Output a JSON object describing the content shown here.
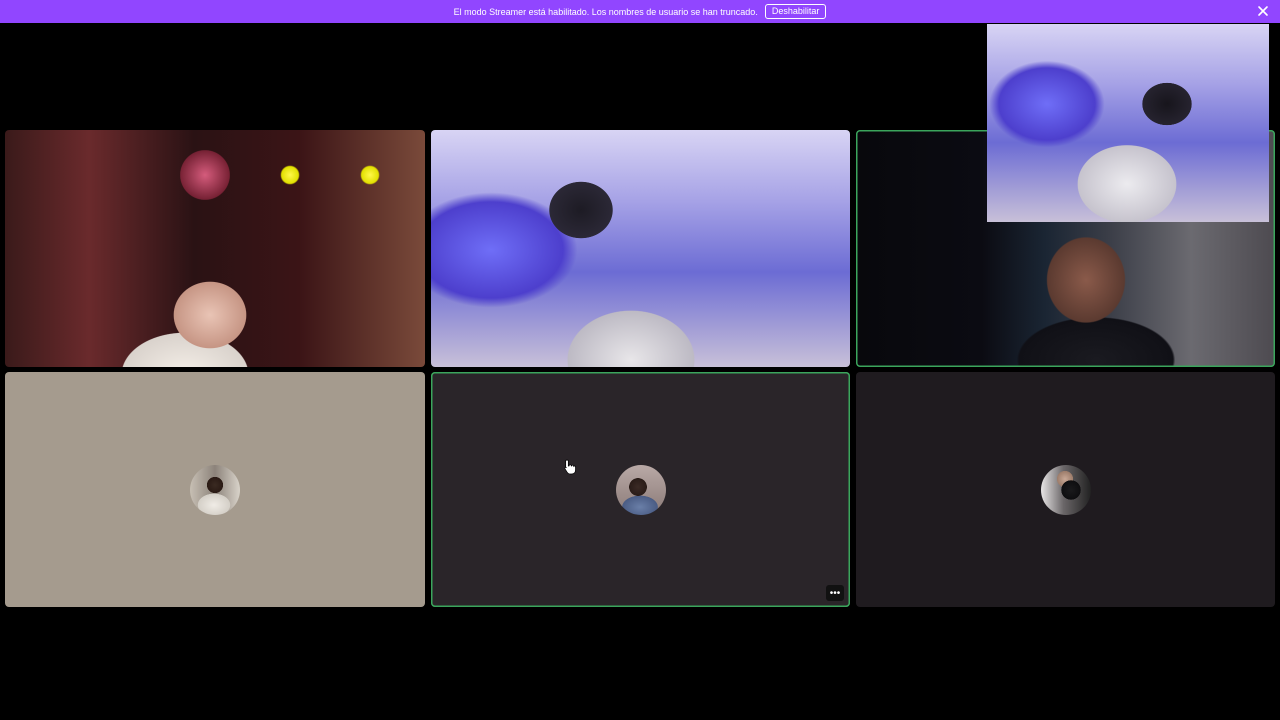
{
  "banner": {
    "message": "El modo Streamer está habilitado. Los nombres de usuario se han truncado.",
    "disable_label": "Deshabilitar",
    "close_icon": "close-icon",
    "background_color": "#9146ff"
  },
  "participants": {
    "video_tiles": [
      {
        "id": "video-1",
        "type": "camera"
      },
      {
        "id": "video-2",
        "type": "camera"
      },
      {
        "id": "video-3",
        "type": "camera",
        "speaking": true
      }
    ],
    "pip": {
      "type": "camera"
    },
    "avatar_tiles": [
      {
        "id": "avatar-1",
        "background_color": "#a59b8e"
      },
      {
        "id": "avatar-2",
        "background_color": "#2a2529",
        "speaking": true,
        "more_label": "•••"
      },
      {
        "id": "avatar-3",
        "background_color": "#1f1b1f"
      }
    ]
  },
  "speaking_color": "#3ba55c"
}
